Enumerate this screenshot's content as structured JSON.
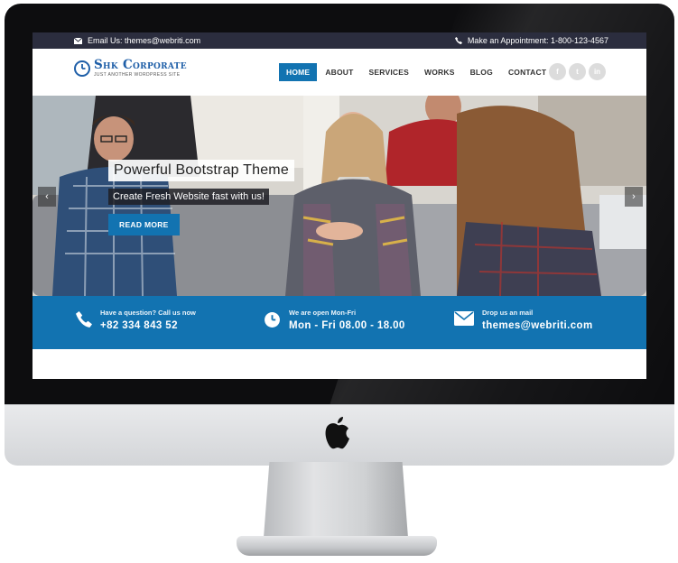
{
  "topbar": {
    "email_text": "Email Us: themes@webriti.com",
    "phone_text": "Make an Appointment: 1-800-123-4567",
    "email_icon": "envelope-icon",
    "phone_icon": "phone-icon"
  },
  "logo": {
    "title": "Shk Corporate",
    "tagline": "JUST ANOTHER WORDPRESS SITE",
    "icon": "clock-icon"
  },
  "nav": {
    "items": [
      "HOME",
      "ABOUT",
      "SERVICES",
      "WORKS",
      "BLOG",
      "CONTACT"
    ],
    "active": "HOME"
  },
  "social": {
    "icons": [
      "facebook-icon",
      "twitter-icon",
      "linkedin-icon"
    ],
    "labels": [
      "f",
      "t",
      "in"
    ]
  },
  "hero": {
    "title": "Powerful Bootstrap Theme",
    "subtitle": "Create Fresh Website fast with us!",
    "button_label": "READ MORE",
    "prev_arrow": "‹",
    "next_arrow": "›"
  },
  "info": [
    {
      "label": "Have a question? Call us now",
      "value": "+82 334 843 52",
      "icon": "phone-icon"
    },
    {
      "label": "We are open Mon-Fri",
      "value": "Mon - Fri 08.00 - 18.00",
      "icon": "clock-icon"
    },
    {
      "label": "Drop us an mail",
      "value": "themes@webriti.com",
      "icon": "envelope-icon"
    }
  ],
  "colors": {
    "accent": "#1273b1",
    "topbar": "#2b2d3e",
    "bezel": "#0d0d0f"
  }
}
